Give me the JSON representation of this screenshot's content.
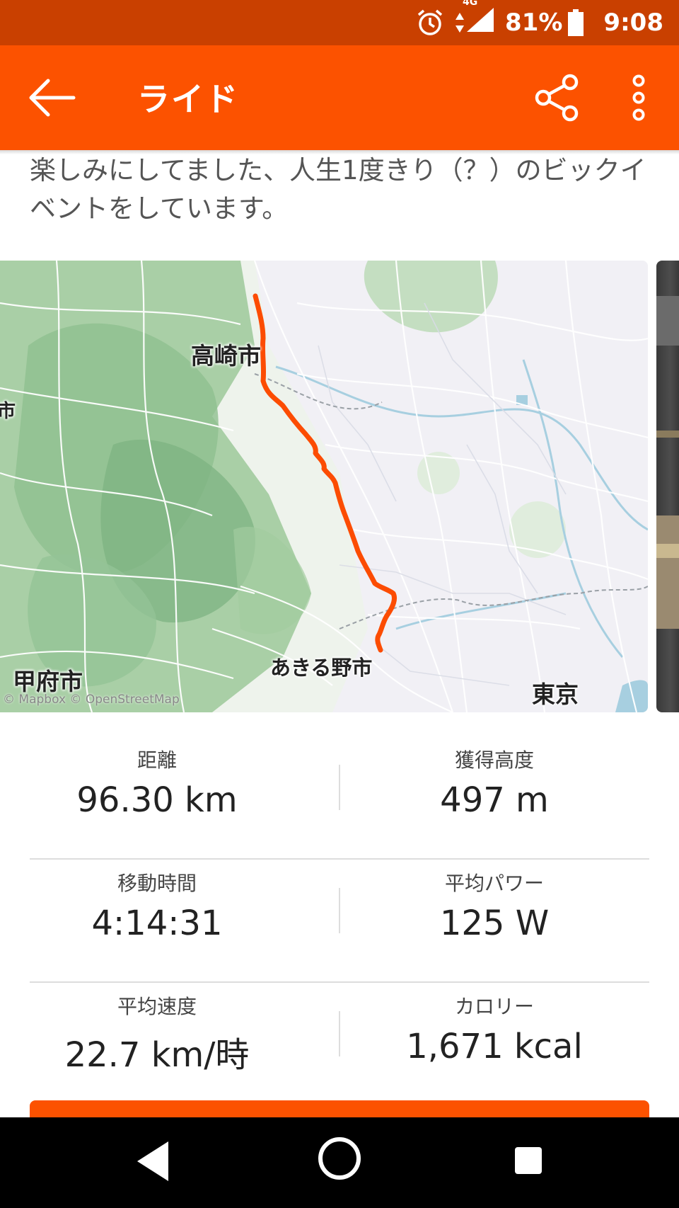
{
  "status_bar": {
    "network": "4G",
    "battery_percent": "81%",
    "time": "9:08"
  },
  "app_bar": {
    "title": "ライド"
  },
  "description": "楽しみにしてました、人生1度きり（？）のビックイベントをしています。",
  "map": {
    "labels": {
      "takasaki": "高崎市",
      "kofu": "甲府市",
      "akiruno": "あきる野市",
      "tokyo": "東京",
      "edge": "市"
    },
    "attribution": "© Mapbox © OpenStreetMap",
    "route_color": "#fc4c02"
  },
  "stats": [
    {
      "left_label": "距離",
      "left_value": "96.30 km",
      "right_label": "獲得高度",
      "right_value": "497 m"
    },
    {
      "left_label": "移動時間",
      "left_value": "4:14:31",
      "right_label": "平均パワー",
      "right_value": "125 W"
    },
    {
      "left_label": "平均速度",
      "left_value": "22.7 km/時",
      "right_label": "カロリー",
      "right_value": "1,671 kcal"
    }
  ],
  "colors": {
    "brand": "#fc5200",
    "status_bar": "#c94000"
  },
  "icons": {
    "alarm": "alarm-icon",
    "signal": "signal-icon",
    "battery": "battery-icon",
    "back": "back-arrow-icon",
    "share": "share-icon",
    "more": "more-vert-icon",
    "nav_back": "nav-back-icon",
    "nav_home": "nav-home-icon",
    "nav_recents": "nav-recents-icon"
  }
}
